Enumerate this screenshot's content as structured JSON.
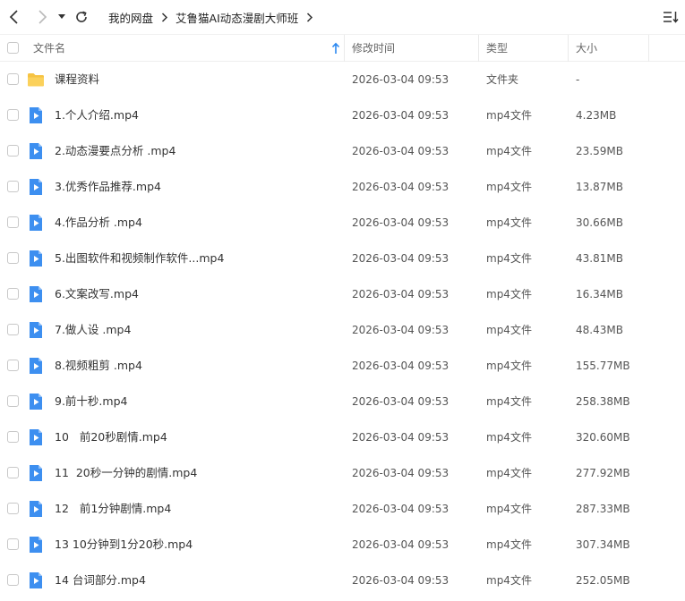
{
  "toolbar": {
    "breadcrumb": [
      "我的网盘",
      "艾鲁猫AI动态漫剧大师班"
    ]
  },
  "columns": {
    "name": "文件名",
    "modified": "修改时间",
    "type": "类型",
    "size": "大小"
  },
  "files": [
    {
      "name": "课程资料",
      "time": "2026-03-04 09:53",
      "type": "文件夹",
      "size": "-",
      "kind": "folder"
    },
    {
      "name": "1.个人介绍.mp4",
      "time": "2026-03-04 09:53",
      "type": "mp4文件",
      "size": "4.23MB",
      "kind": "video"
    },
    {
      "name": "2.动态漫要点分析 .mp4",
      "time": "2026-03-04 09:53",
      "type": "mp4文件",
      "size": "23.59MB",
      "kind": "video"
    },
    {
      "name": "3.优秀作品推荐.mp4",
      "time": "2026-03-04 09:53",
      "type": "mp4文件",
      "size": "13.87MB",
      "kind": "video"
    },
    {
      "name": "4.作品分析 .mp4",
      "time": "2026-03-04 09:53",
      "type": "mp4文件",
      "size": "30.66MB",
      "kind": "video"
    },
    {
      "name": "5.出图软件和视频制作软件...mp4",
      "time": "2026-03-04 09:53",
      "type": "mp4文件",
      "size": "43.81MB",
      "kind": "video"
    },
    {
      "name": "6.文案改写.mp4",
      "time": "2026-03-04 09:53",
      "type": "mp4文件",
      "size": "16.34MB",
      "kind": "video"
    },
    {
      "name": "7.做人设 .mp4",
      "time": "2026-03-04 09:53",
      "type": "mp4文件",
      "size": "48.43MB",
      "kind": "video"
    },
    {
      "name": "8.视频粗剪 .mp4",
      "time": "2026-03-04 09:53",
      "type": "mp4文件",
      "size": "155.77MB",
      "kind": "video"
    },
    {
      "name": "9.前十秒.mp4",
      "time": "2026-03-04 09:53",
      "type": "mp4文件",
      "size": "258.38MB",
      "kind": "video"
    },
    {
      "name": "10   前20秒剧情.mp4",
      "time": "2026-03-04 09:53",
      "type": "mp4文件",
      "size": "320.60MB",
      "kind": "video"
    },
    {
      "name": "11  20秒一分钟的剧情.mp4",
      "time": "2026-03-04 09:53",
      "type": "mp4文件",
      "size": "277.92MB",
      "kind": "video"
    },
    {
      "name": "12   前1分钟剧情.mp4",
      "time": "2026-03-04 09:53",
      "type": "mp4文件",
      "size": "287.33MB",
      "kind": "video"
    },
    {
      "name": "13 10分钟到1分20秒.mp4",
      "time": "2026-03-04 09:53",
      "type": "mp4文件",
      "size": "307.34MB",
      "kind": "video"
    },
    {
      "name": "14 台词部分.mp4",
      "time": "2026-03-04 09:53",
      "type": "mp4文件",
      "size": "252.05MB",
      "kind": "video"
    }
  ],
  "colors": {
    "folder": "#f6c343",
    "video": "#3d8ff0",
    "accent": "#2b88f0"
  }
}
